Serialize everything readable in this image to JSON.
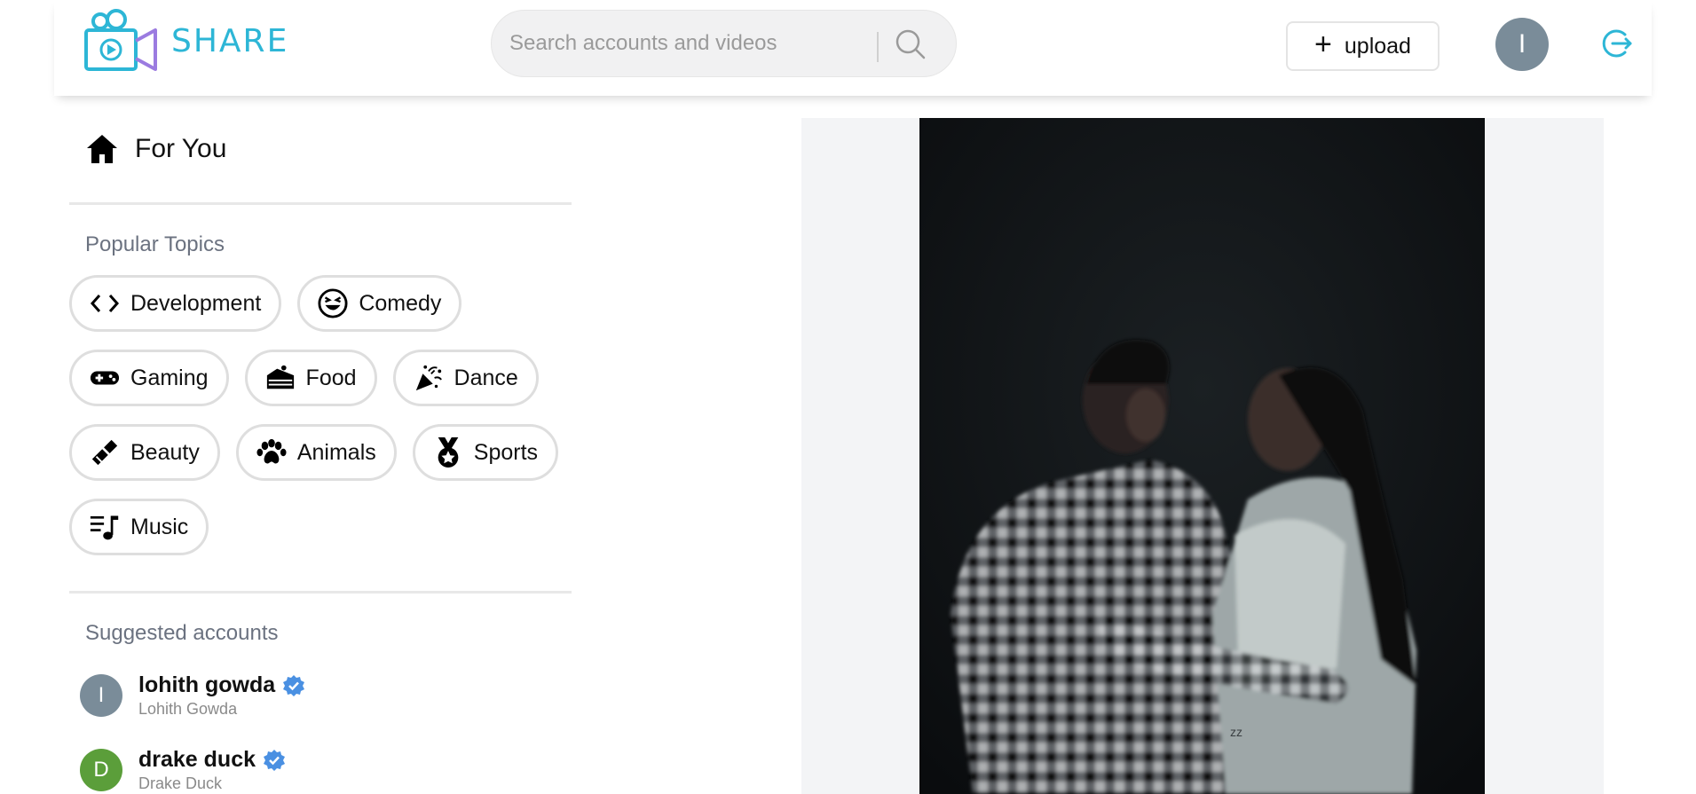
{
  "brand": {
    "name": "SHARE",
    "color": "#2db6d6"
  },
  "search": {
    "placeholder": "Search accounts and videos",
    "icon": "search-icon"
  },
  "header": {
    "upload_label": "upload",
    "user_initial": "I",
    "logout_icon": "logout-icon"
  },
  "sidebar": {
    "for_you_label": "For You",
    "popular_topics_title": "Popular Topics",
    "topics": [
      {
        "label": "Development",
        "icon": "code-icon"
      },
      {
        "label": "Comedy",
        "icon": "laughing-face-icon"
      },
      {
        "label": "Gaming",
        "icon": "gamepad-icon"
      },
      {
        "label": "Food",
        "icon": "cake-icon"
      },
      {
        "label": "Dance",
        "icon": "party-popper-icon"
      },
      {
        "label": "Beauty",
        "icon": "lipstick-icon"
      },
      {
        "label": "Animals",
        "icon": "paw-icon"
      },
      {
        "label": "Sports",
        "icon": "medal-icon"
      },
      {
        "label": "Music",
        "icon": "music-icon"
      }
    ],
    "suggested_title": "Suggested accounts",
    "accounts": [
      {
        "name": "lohith gowda",
        "display_name": "Lohith Gowda",
        "initial": "I",
        "color": "#7a8c99",
        "verified": true
      },
      {
        "name": "drake duck",
        "display_name": "Drake Duck",
        "initial": "D",
        "color": "#5b9e3a",
        "verified": true
      }
    ]
  },
  "video": {
    "watermark": "zz"
  }
}
